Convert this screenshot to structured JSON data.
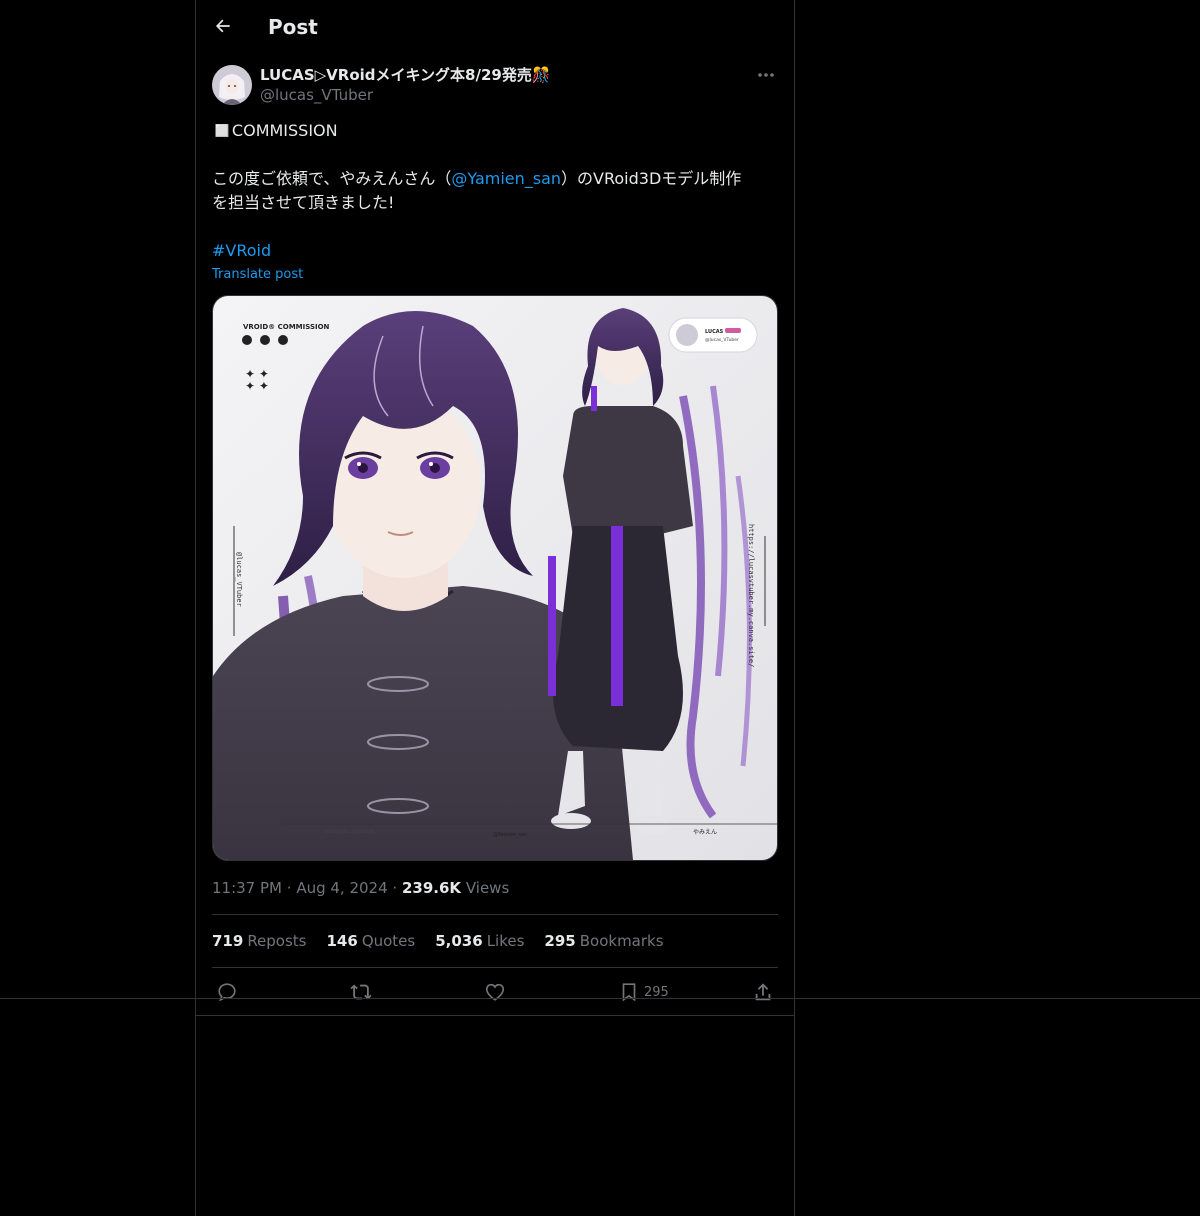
{
  "header": {
    "title": "Post",
    "back_icon": "arrow-left-icon"
  },
  "author": {
    "display_name": "LUCAS▷VRoidメイキング本8/29発売🎊",
    "handle": "@lucas_VTuber"
  },
  "post": {
    "line1": "◻️COMMISSION",
    "line2_before": "この度ご依頼で、やみえんさん（",
    "line2_mention": "@Yamien_san",
    "line2_after": "）のVRoid3Dモデル制作",
    "line3": "を担当させて頂きました!",
    "hashtag": "#VRoid",
    "translate_label": "Translate post"
  },
  "image": {
    "card_title": "VROID® COMMISSION",
    "watermark_handle": "@lucas_VTuber",
    "side_url": "https://lucasvtuber.my.canva.site/",
    "profile_chip_name": "LUCAS",
    "profile_chip_handle": "@lucas_VTuber",
    "footer_client": "@Yamien_san",
    "footer_name": "やみえん",
    "footer_url": "sketchfab.com/lucas"
  },
  "meta": {
    "time": "11:37 PM",
    "date": "Aug 4, 2024",
    "views_count": "239.6K",
    "views_label": "Views",
    "sep": "·"
  },
  "stats": {
    "reposts_count": "719",
    "reposts_label": "Reposts",
    "quotes_count": "146",
    "quotes_label": "Quotes",
    "likes_count": "5,036",
    "likes_label": "Likes",
    "bookmarks_count": "295",
    "bookmarks_label": "Bookmarks"
  },
  "actions": {
    "bookmark_count": "295"
  },
  "colors": {
    "background": "#000000",
    "text": "#e7e9ea",
    "muted": "#71767b",
    "accent": "#1d9bf0",
    "border": "#2f3336",
    "hair_purple": "#4a2f6b"
  }
}
